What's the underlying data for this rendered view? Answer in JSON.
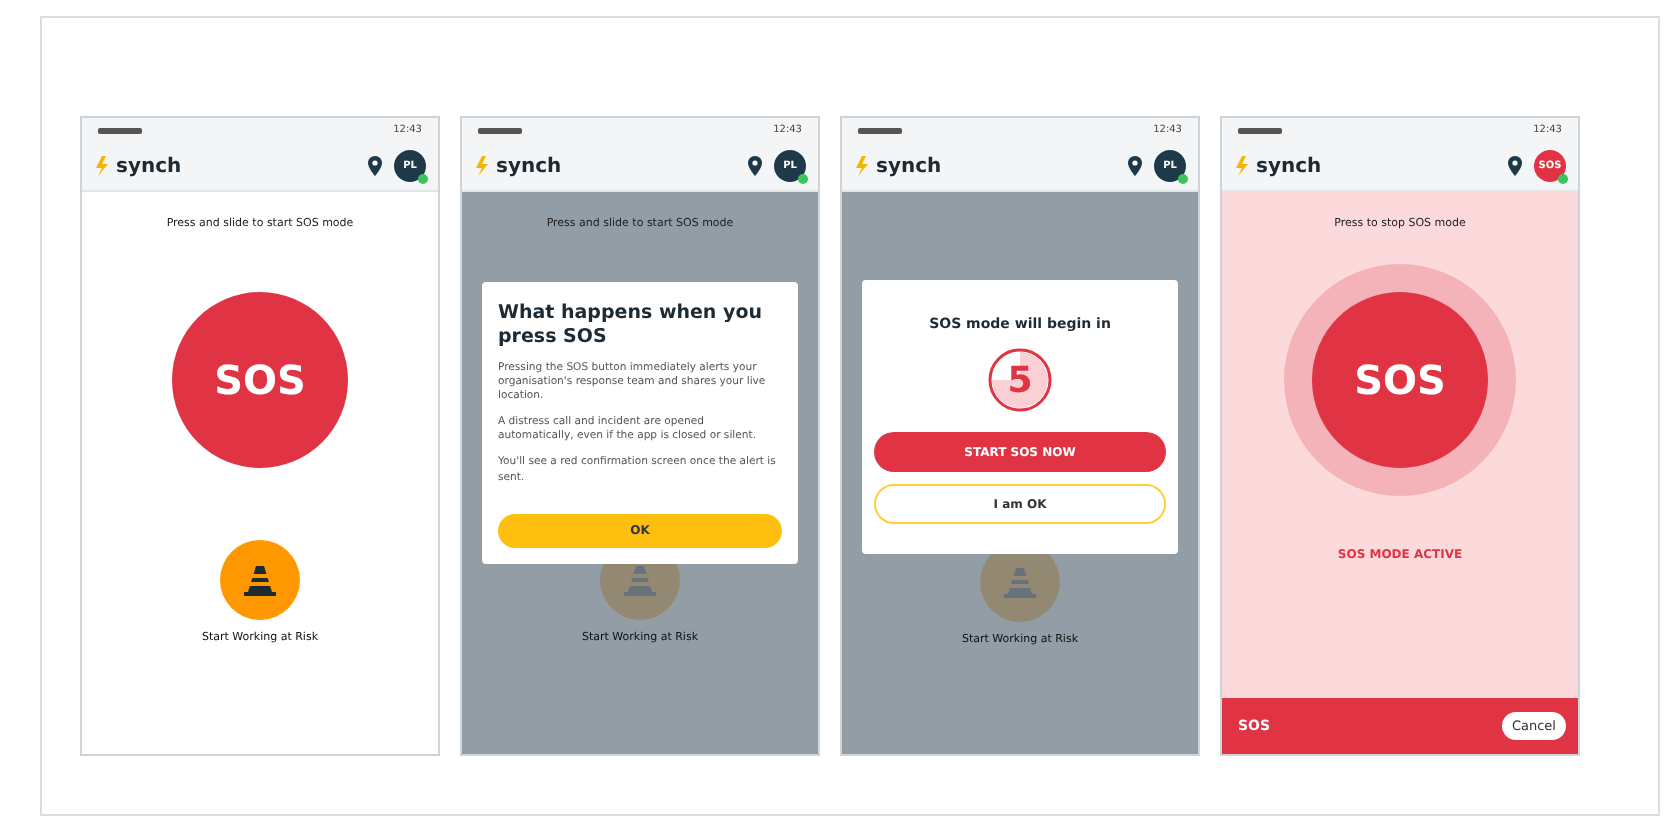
{
  "phones": [
    {
      "status_time": "12:43",
      "logo": "synch",
      "avatar": {
        "alert": false,
        "text": "PL"
      },
      "tinted": false,
      "hint": "Press and slide to start SOS mode",
      "sos_label": "SOS",
      "sos_active": false,
      "risk_label": "Start Working at Risk",
      "overlay": false
    },
    {
      "status_time": "12:43",
      "logo": "synch",
      "avatar": {
        "alert": false,
        "text": "PL"
      },
      "tinted": false,
      "hint": "Press and slide to start SOS mode",
      "risk_label": "Start Working at Risk",
      "overlay": true,
      "dialog": {
        "kind": "info",
        "title": "What happens when you press SOS",
        "paragraphs": [
          "Pressing the SOS button immediately alerts your organisation's response team and shares your live location.",
          "A distress call and incident are opened automatically, even if the app is closed or silent.",
          "You'll see a red confirmation screen once the alert is sent."
        ],
        "button": "OK"
      }
    },
    {
      "status_time": "12:43",
      "logo": "synch",
      "avatar": {
        "alert": false,
        "text": "PL"
      },
      "tinted": false,
      "risk_label": "Start Working at Risk",
      "overlay": true,
      "dialog": {
        "kind": "countdown",
        "title": "SOS mode will begin in",
        "count": "5",
        "primary": "START SOS NOW",
        "secondary": "I am OK"
      }
    },
    {
      "status_time": "12:43",
      "logo": "synch",
      "avatar": {
        "alert": true,
        "text": "SOS"
      },
      "tinted": true,
      "hint": "Press to stop SOS mode",
      "sos_label": "SOS",
      "sos_active": true,
      "status_label": "SOS MODE ACTIVE",
      "overlay": false,
      "footer": {
        "label": "SOS",
        "button": "Cancel"
      }
    }
  ]
}
